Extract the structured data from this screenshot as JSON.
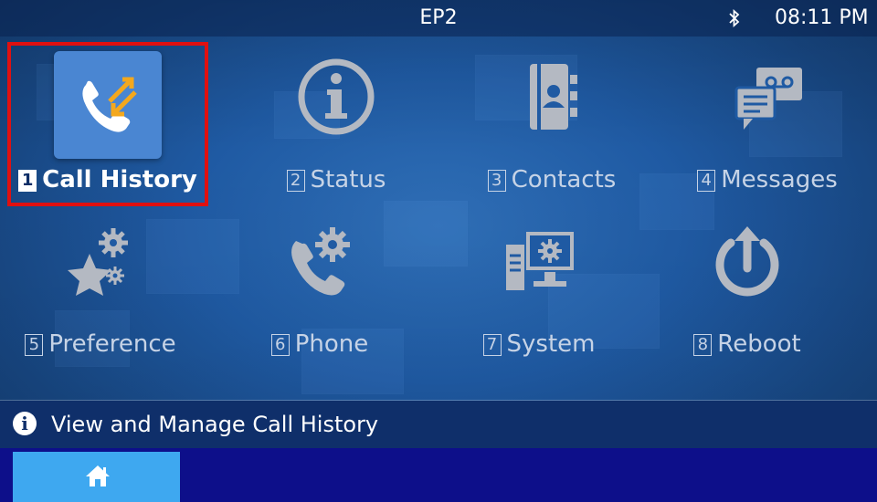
{
  "status_bar": {
    "title": "EP2",
    "time": "08:11 PM"
  },
  "menu": [
    {
      "num": "1",
      "label": "Call History",
      "icon": "call-history-icon",
      "selected": true
    },
    {
      "num": "2",
      "label": "Status",
      "icon": "info-circle-icon"
    },
    {
      "num": "3",
      "label": "Contacts",
      "icon": "contacts-book-icon"
    },
    {
      "num": "4",
      "label": "Messages",
      "icon": "voicemail-messages-icon"
    },
    {
      "num": "5",
      "label": "Preference",
      "icon": "star-gear-icon"
    },
    {
      "num": "6",
      "label": "Phone",
      "icon": "phone-gear-icon"
    },
    {
      "num": "7",
      "label": "System",
      "icon": "system-monitor-icon"
    },
    {
      "num": "8",
      "label": "Reboot",
      "icon": "power-reboot-icon"
    }
  ],
  "info_bar": {
    "text": "View and Manage Call History"
  },
  "bottom_bar": {
    "home_icon": "home-icon"
  },
  "colors": {
    "accent": "#3ea8f0",
    "selection_outline": "#e01010",
    "label_gray": "#c6d3e6",
    "icon_gray": "#b4b9c2"
  }
}
